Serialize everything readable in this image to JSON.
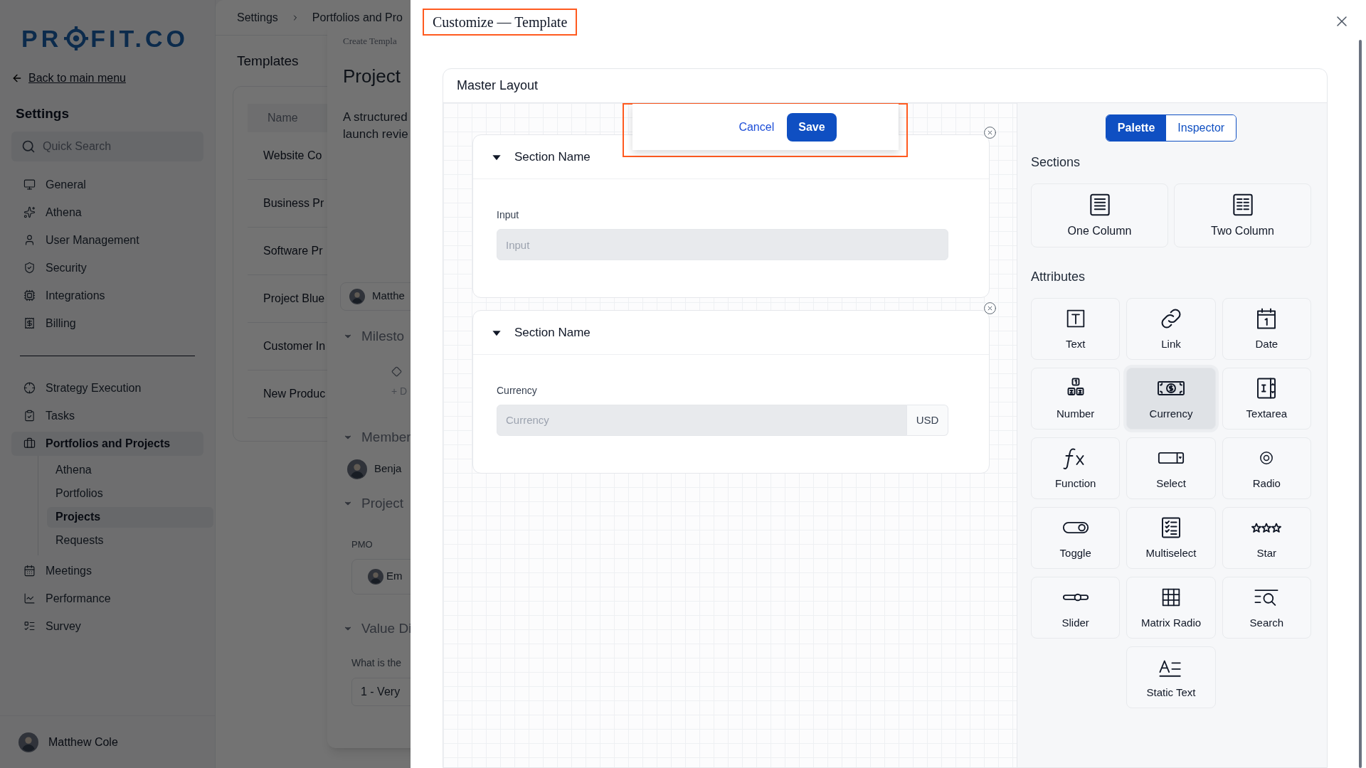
{
  "sidebar": {
    "logo": {
      "before": "PR",
      "after": "FIT.CO"
    },
    "back_link": "Back to main menu",
    "heading": "Settings",
    "search": {
      "placeholder": "Quick Search"
    },
    "groups": [
      [
        {
          "label": "General",
          "selected": false
        },
        {
          "label": "Athena",
          "selected": false
        },
        {
          "label": "User Management",
          "selected": false
        },
        {
          "label": "Security",
          "selected": false
        },
        {
          "label": "Integrations",
          "selected": false
        },
        {
          "label": "Billing",
          "selected": false
        }
      ],
      [
        {
          "label": "Strategy Execution",
          "selected": false
        },
        {
          "label": "Tasks",
          "selected": false
        },
        {
          "label": "Portfolios and Projects",
          "selected": true,
          "children": [
            {
              "label": "Athena",
              "selected": false
            },
            {
              "label": "Portfolios",
              "selected": false
            },
            {
              "label": "Projects",
              "selected": true
            },
            {
              "label": "Requests",
              "selected": false
            }
          ]
        },
        {
          "label": "Meetings",
          "selected": false
        },
        {
          "label": "Performance",
          "selected": false
        },
        {
          "label": "Survey",
          "selected": false
        }
      ]
    ],
    "user": {
      "name": "Matthew Cole"
    }
  },
  "main": {
    "breadcrumb": [
      "Settings",
      "Portfolios and Pro"
    ],
    "title": "Templates",
    "table": {
      "column": "Name",
      "rows": [
        "Website Co",
        "Business Pr",
        "Software Pr",
        "Project Blue",
        "Customer In",
        "New Produc"
      ]
    }
  },
  "drawer": {
    "caption": "Create Templa",
    "title": "Project",
    "description_lines": [
      "A structured",
      "launch revie"
    ],
    "owner_chip": "Matthe",
    "milestones": {
      "title": "Milesto",
      "add": "+ D"
    },
    "members": {
      "title": "Member",
      "chip": "Benja"
    },
    "project_group": {
      "title": "Project",
      "field_label": "PMO",
      "chip": "Em"
    },
    "value": {
      "title": "Value Di",
      "question": "What is the",
      "answer": "1 - Very"
    }
  },
  "modal": {
    "title": "Customize — Template",
    "layout": {
      "title": "Master Layout",
      "sections": [
        {
          "title": "Section Name",
          "expanded": true,
          "field": {
            "kind": "text",
            "label": "Input",
            "placeholder": "Input"
          }
        },
        {
          "title": "Section Name",
          "expanded": true,
          "field": {
            "kind": "currency",
            "label": "Currency",
            "placeholder": "Currency",
            "suffix": "USD"
          }
        }
      ]
    },
    "actions": {
      "cancel": "Cancel",
      "save": "Save"
    },
    "palette": {
      "tabs": [
        {
          "label": "Palette",
          "selected": true
        },
        {
          "label": "Inspector",
          "selected": false
        }
      ],
      "sections_heading": "Sections",
      "sections": [
        {
          "label": "One Column"
        },
        {
          "label": "Two Column"
        }
      ],
      "attributes_heading": "Attributes",
      "attributes": [
        {
          "label": "Text",
          "selected": false
        },
        {
          "label": "Link",
          "selected": false
        },
        {
          "label": "Date",
          "selected": false
        },
        {
          "label": "Number",
          "selected": false
        },
        {
          "label": "Currency",
          "selected": true
        },
        {
          "label": "Textarea",
          "selected": false
        },
        {
          "label": "Function",
          "selected": false
        },
        {
          "label": "Select",
          "selected": false
        },
        {
          "label": "Radio",
          "selected": false
        },
        {
          "label": "Toggle",
          "selected": false
        },
        {
          "label": "Multiselect",
          "selected": false
        },
        {
          "label": "Star",
          "selected": false
        },
        {
          "label": "Slider",
          "selected": false
        },
        {
          "label": "Matrix Radio",
          "selected": false
        },
        {
          "label": "Search",
          "selected": false
        },
        {
          "label": "Static Text",
          "selected": false
        }
      ]
    }
  }
}
